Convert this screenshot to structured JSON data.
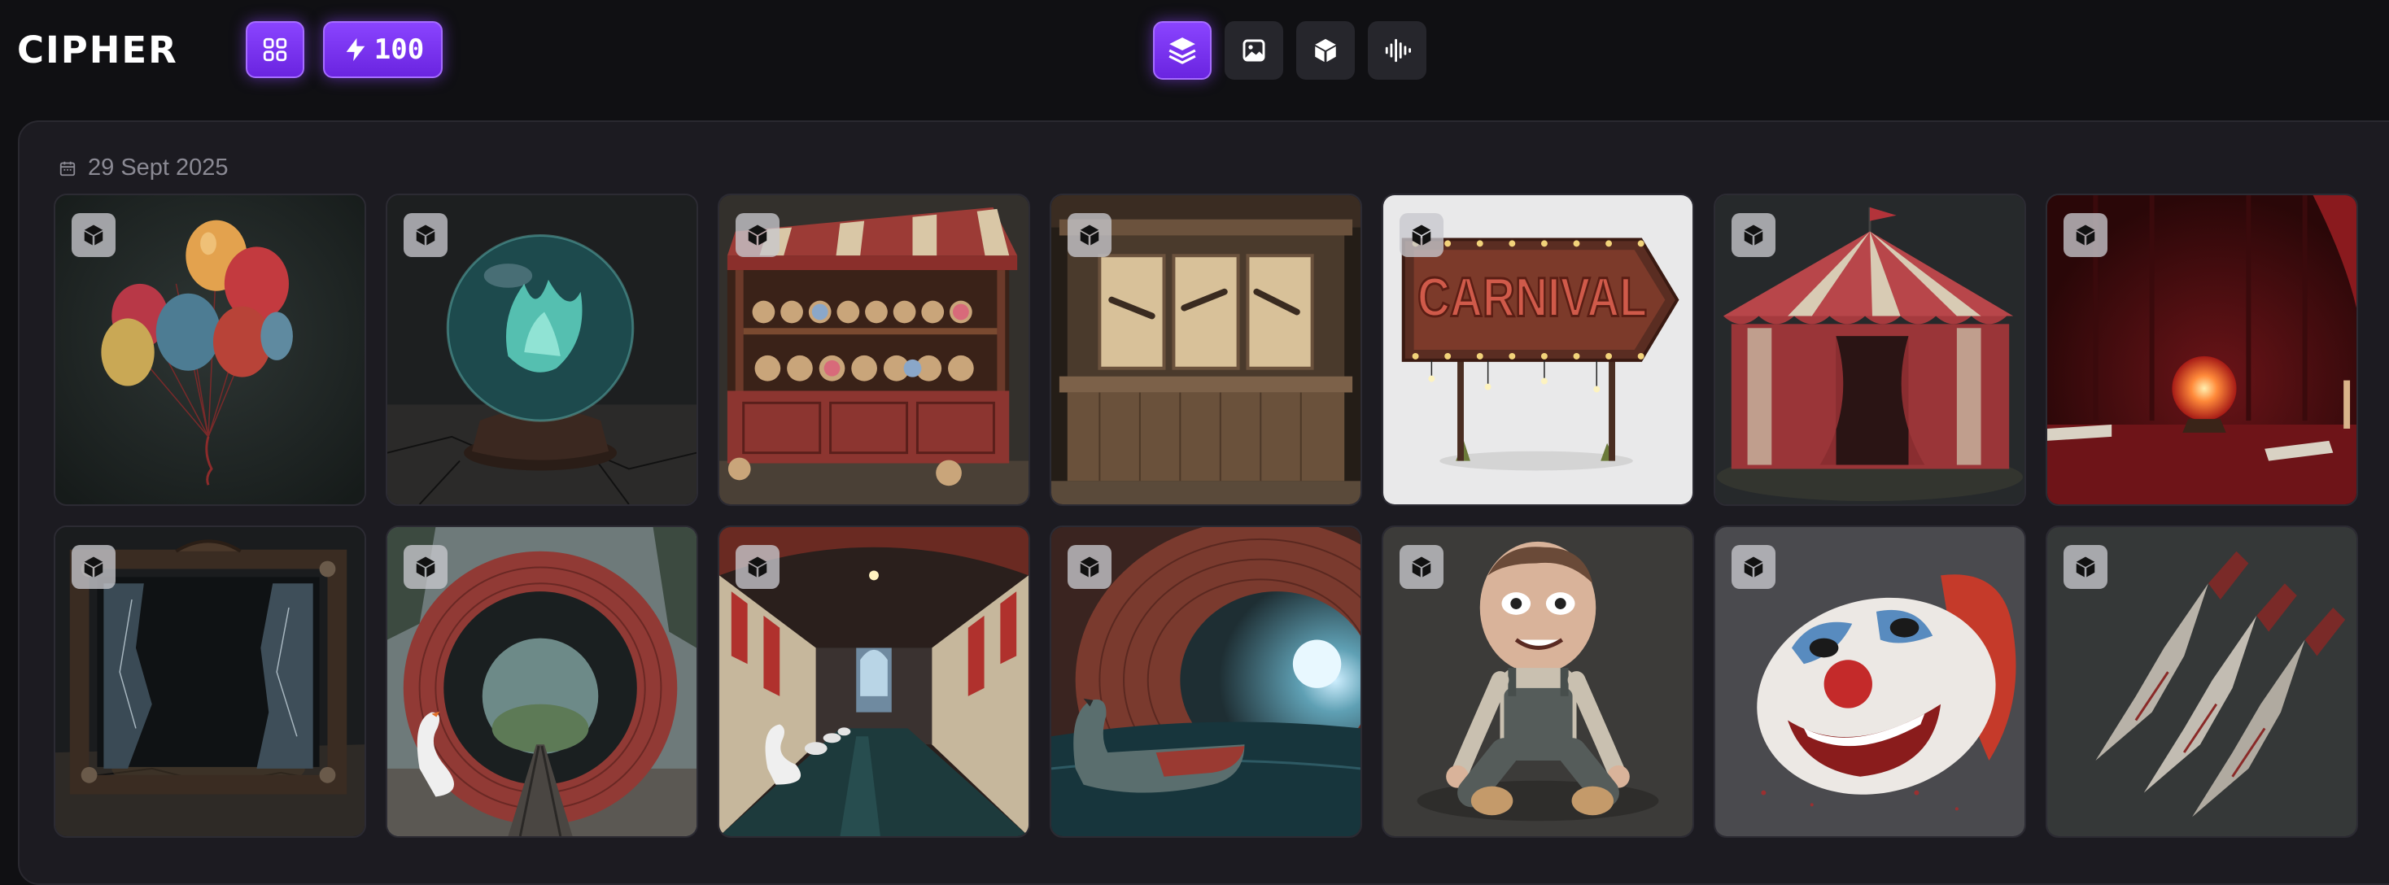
{
  "app": {
    "logo_text": "CIPHER"
  },
  "header": {
    "credits": "100",
    "modes": [
      {
        "name": "all-layers",
        "icon": "layers-icon",
        "active": true
      },
      {
        "name": "images",
        "icon": "image-icon",
        "active": false
      },
      {
        "name": "3d-models",
        "icon": "cube-icon",
        "active": false
      },
      {
        "name": "audio",
        "icon": "audio-wave-icon",
        "active": false
      }
    ]
  },
  "gallery": {
    "date": "29 Sept 2025",
    "items": [
      {
        "subject": "balloons",
        "type": "3d-model"
      },
      {
        "subject": "crystal-ball",
        "type": "3d-model"
      },
      {
        "subject": "plush-booth",
        "type": "3d-model"
      },
      {
        "subject": "shooting-gallery",
        "type": "3d-model"
      },
      {
        "subject": "carnival-sign",
        "type": "3d-model",
        "sign_text": "CARNIVAL"
      },
      {
        "subject": "circus-tent",
        "type": "3d-model"
      },
      {
        "subject": "fortune-table",
        "type": "3d-model"
      },
      {
        "subject": "broken-mirror-frame",
        "type": "3d-model"
      },
      {
        "subject": "tunnel-with-swan",
        "type": "3d-model"
      },
      {
        "subject": "tunnel-of-love-swans",
        "type": "3d-model"
      },
      {
        "subject": "swan-boat-tunnel",
        "type": "3d-model"
      },
      {
        "subject": "creepy-doll",
        "type": "3d-model"
      },
      {
        "subject": "clown-mask",
        "type": "3d-model"
      },
      {
        "subject": "throwing-knives",
        "type": "3d-model"
      }
    ]
  }
}
